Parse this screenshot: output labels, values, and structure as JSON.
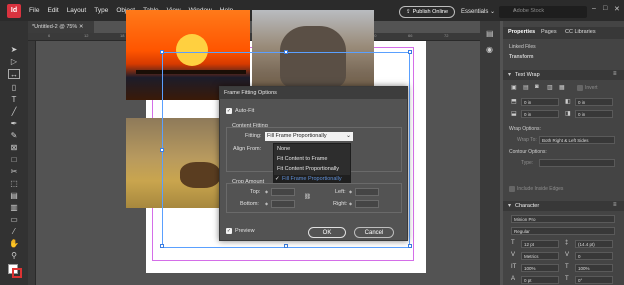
{
  "colors": {
    "menubar": "#2b2b2b",
    "panel": "#444444",
    "dialog": "#535353",
    "selection": "#5aa0ff",
    "app_logo": "#d9333f"
  },
  "menubar": {
    "logo": "Id",
    "items": [
      "File",
      "Edit",
      "Layout",
      "Type",
      "Object",
      "Table",
      "View",
      "Window",
      "Help"
    ],
    "publish_label": "Publish Online",
    "workspace": "Essentials",
    "search_placeholder": "Adobe Stock"
  },
  "document": {
    "tab_title": "*Untitled-2 @ 75%",
    "ruler_numbers": [
      "6",
      "12",
      "18",
      "24",
      "30",
      "36",
      "42",
      "48",
      "54",
      "60",
      "66",
      "72",
      "78"
    ]
  },
  "dialog": {
    "title": "Frame Fitting Options",
    "auto_fit_label": "Auto-Fit",
    "auto_fit_checked": true,
    "content_fitting_label": "Content Fitting",
    "fitting_label": "Fitting:",
    "fitting_value": "Fill Frame Proportionally",
    "fitting_options": [
      "None",
      "Fit Content to Frame",
      "Fit Content Proportionally",
      "Fill Frame Proportionally"
    ],
    "selected_option_index": 3,
    "align_from_label": "Align From:",
    "crop_amount_label": "Crop Amount",
    "top_label": "Top:",
    "bottom_label": "Bottom:",
    "left_label": "Left:",
    "right_label": "Right:",
    "preview_label": "Preview",
    "preview_checked": true,
    "ok_label": "OK",
    "cancel_label": "Cancel"
  },
  "panel": {
    "tabs": [
      "Properties",
      "Pages",
      "CC Libraries"
    ],
    "linked_files": "Linked Files",
    "transform_header": "Transform",
    "text_wrap": {
      "header": "Text Wrap",
      "top": "0 in",
      "bottom": "0 in",
      "left": "0 in",
      "right": "0 in",
      "invert": "Invert",
      "wrap_options_label": "Wrap Options:",
      "wrap_to_label": "Wrap To:",
      "wrap_to_value": "Both Right & Left Sides",
      "contour_options_label": "Contour Options:",
      "type_label": "Type:",
      "include_edges": "Include Inside Edges"
    },
    "character": {
      "header": "Character",
      "font": "Minion Pro",
      "style": "Regular",
      "size": "12 pt",
      "leading": "(14.4 pt)",
      "kerning": "Metrics",
      "tracking": "0",
      "vscale": "100%",
      "hscale": "100%",
      "baseline": "0 pt",
      "skew": "0°"
    }
  }
}
